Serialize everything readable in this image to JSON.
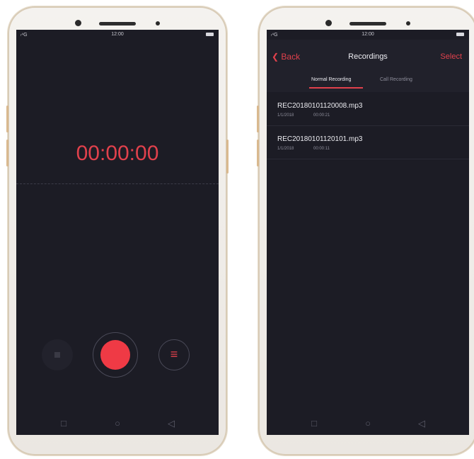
{
  "status_bar": {
    "time": "12:00",
    "signal": "ₗ⁴G"
  },
  "recorder": {
    "timer": "00:00:00",
    "list_icon": "≡"
  },
  "recordings": {
    "back_label": "Back",
    "title": "Recordings",
    "select_label": "Select",
    "tabs": [
      {
        "label": "Normal Recording",
        "selected": true
      },
      {
        "label": "Call Recording",
        "selected": false
      }
    ],
    "items": [
      {
        "name": "REC20180101120008.mp3",
        "date": "1/1/2018",
        "duration": "00:00:21"
      },
      {
        "name": "REC20180101120101.mp3",
        "date": "1/1/2018",
        "duration": "00:00:11"
      }
    ]
  },
  "nav_icons": {
    "square": "□",
    "circle": "○",
    "triangle": "◁"
  },
  "colors": {
    "accent": "#e1414c",
    "screen_bg": "#1c1c25",
    "record_button": "#ef3a45"
  }
}
